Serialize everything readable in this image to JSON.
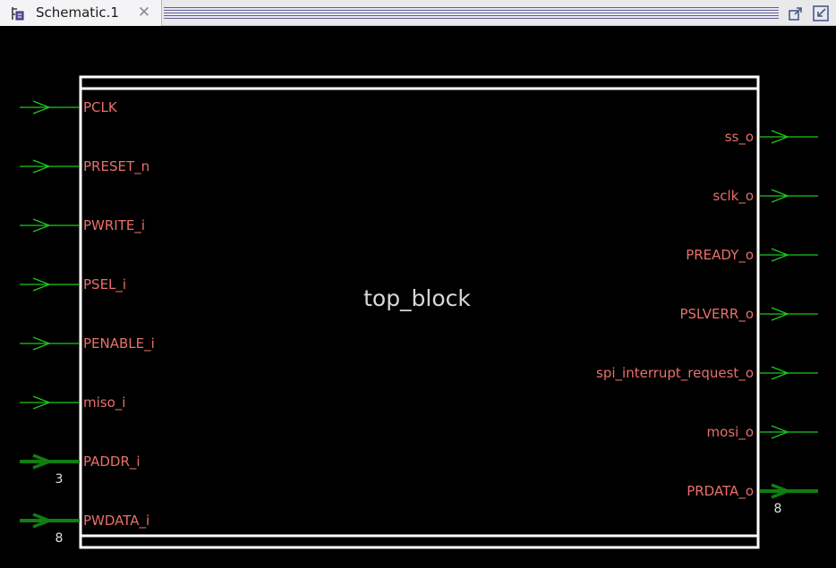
{
  "tab": {
    "title": "Schematic.1",
    "close_glyph": "✕",
    "icon": "schematic-icon"
  },
  "window_controls": {
    "restore_icon": "float-window-icon",
    "minimize_icon": "minimize-window-icon"
  },
  "colors": {
    "background": "#000000",
    "block_outline": "#ffffff",
    "port_label": "#e8706a",
    "net_wire": "#1ec81e",
    "bus_wire": "#107e10",
    "block_title": "#d8d8d8",
    "bus_width_text": "#e0e0e0"
  },
  "block": {
    "name": "top_block",
    "inputs": [
      {
        "name": "PCLK",
        "bus": false,
        "width": ""
      },
      {
        "name": "PRESET_n",
        "bus": false,
        "width": ""
      },
      {
        "name": "PWRITE_i",
        "bus": false,
        "width": ""
      },
      {
        "name": "PSEL_i",
        "bus": false,
        "width": ""
      },
      {
        "name": "PENABLE_i",
        "bus": false,
        "width": ""
      },
      {
        "name": "miso_i",
        "bus": false,
        "width": ""
      },
      {
        "name": "PADDR_i",
        "bus": true,
        "width": "3"
      },
      {
        "name": "PWDATA_i",
        "bus": true,
        "width": "8"
      }
    ],
    "outputs": [
      {
        "name": "ss_o",
        "bus": false,
        "width": ""
      },
      {
        "name": "sclk_o",
        "bus": false,
        "width": ""
      },
      {
        "name": "PREADY_o",
        "bus": false,
        "width": ""
      },
      {
        "name": "PSLVERR_o",
        "bus": false,
        "width": ""
      },
      {
        "name": "spi_interrupt_request_o",
        "bus": false,
        "width": ""
      },
      {
        "name": "mosi_o",
        "bus": false,
        "width": ""
      },
      {
        "name": "PRDATA_o",
        "bus": true,
        "width": "8"
      }
    ]
  }
}
